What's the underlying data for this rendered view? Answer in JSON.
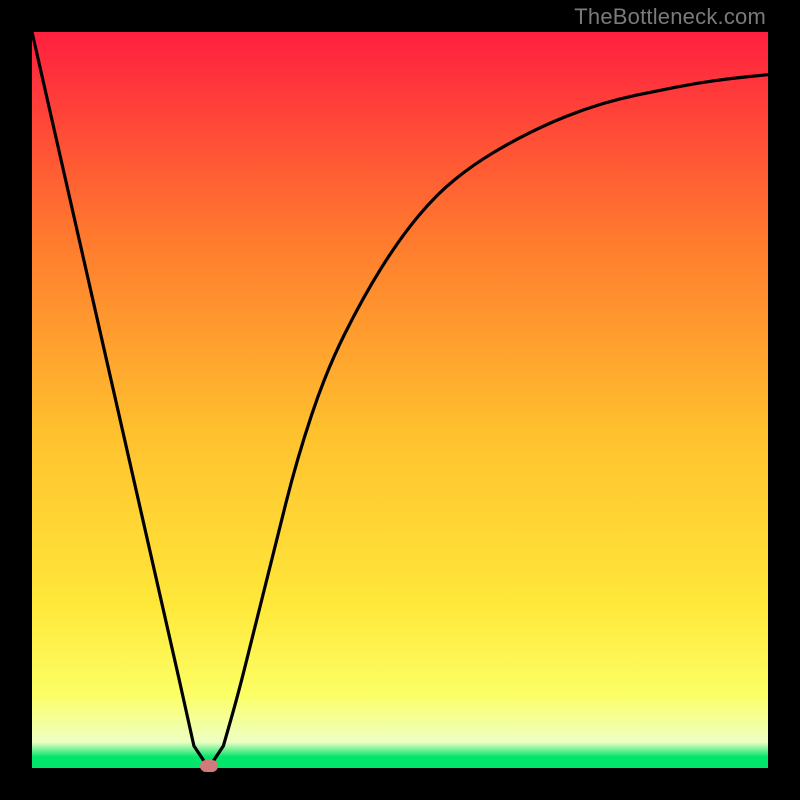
{
  "watermark": "TheBottleneck.com",
  "colors": {
    "bg_black": "#000000",
    "grad_top": "#ff1f3f",
    "grad_mid1": "#ff7a2e",
    "grad_mid2": "#ffc22e",
    "grad_mid3": "#ffe83a",
    "grad_low": "#fcff66",
    "grad_pale": "#edffc4",
    "grad_green": "#00e56a",
    "curve": "#000000",
    "marker": "#cf7b7b"
  },
  "chart_data": {
    "type": "line",
    "title": "",
    "xlabel": "",
    "ylabel": "",
    "xlim": [
      0,
      100
    ],
    "ylim": [
      0,
      100
    ],
    "series": [
      {
        "name": "bottleneck-curve",
        "x": [
          0,
          5,
          10,
          15,
          20,
          22,
          24,
          26,
          28,
          30,
          33,
          36,
          40,
          45,
          50,
          55,
          60,
          65,
          70,
          75,
          80,
          85,
          90,
          95,
          100
        ],
        "y": [
          100,
          78,
          56,
          34,
          12,
          3,
          0,
          3,
          10,
          18,
          30,
          42,
          54,
          64,
          72,
          78,
          82,
          85,
          87.5,
          89.5,
          91,
          92,
          93,
          93.7,
          94.2
        ]
      }
    ],
    "marker": {
      "x": 24,
      "y": 0
    },
    "legend": false,
    "grid": false
  }
}
